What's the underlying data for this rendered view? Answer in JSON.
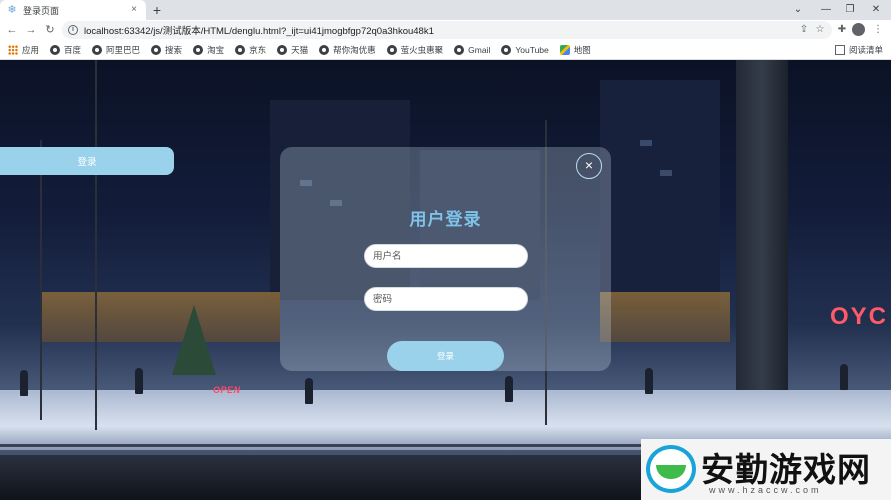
{
  "browser": {
    "tab_title": "登录页面",
    "tab_close": "×",
    "new_tab": "+",
    "url": "localhost:63342/js/测试版本/HTML/denglu.html?_ijt=ui41jmogbfgp72q0a3hkou48k1",
    "window_controls": {
      "dropdown": "⌄",
      "minimize": "—",
      "maximize": "❐",
      "close": "✕"
    }
  },
  "bookmarks": [
    {
      "label": "应用",
      "icon": "apps-grid-icon"
    },
    {
      "label": "百度",
      "icon": "globe-icon"
    },
    {
      "label": "阿里巴巴",
      "icon": "globe-icon"
    },
    {
      "label": "搜索",
      "icon": "globe-icon"
    },
    {
      "label": "淘宝",
      "icon": "globe-icon"
    },
    {
      "label": "京东",
      "icon": "globe-icon"
    },
    {
      "label": "天猫",
      "icon": "globe-icon"
    },
    {
      "label": "帮你淘优惠",
      "icon": "globe-icon"
    },
    {
      "label": "萤火虫惠聚",
      "icon": "globe-icon"
    },
    {
      "label": "Gmail",
      "icon": "globe-icon"
    },
    {
      "label": "YouTube",
      "icon": "globe-icon"
    },
    {
      "label": "地图",
      "icon": "maps-icon"
    }
  ],
  "reading_list": "阅读清单",
  "page": {
    "side_button": "登录",
    "login": {
      "close": "×",
      "title": "用户登录",
      "username_placeholder": "用户名",
      "password_placeholder": "密码",
      "submit": "登录"
    },
    "scene_signs": {
      "open": "OPEN",
      "neon": "OYC"
    }
  },
  "watermark": {
    "text": "安勤游戏网",
    "url": "www.hzaccw.com"
  },
  "colors": {
    "accent": "#9ad2ec",
    "title": "#7ec3e8",
    "panel": "rgba(210,225,240,0.28)"
  }
}
